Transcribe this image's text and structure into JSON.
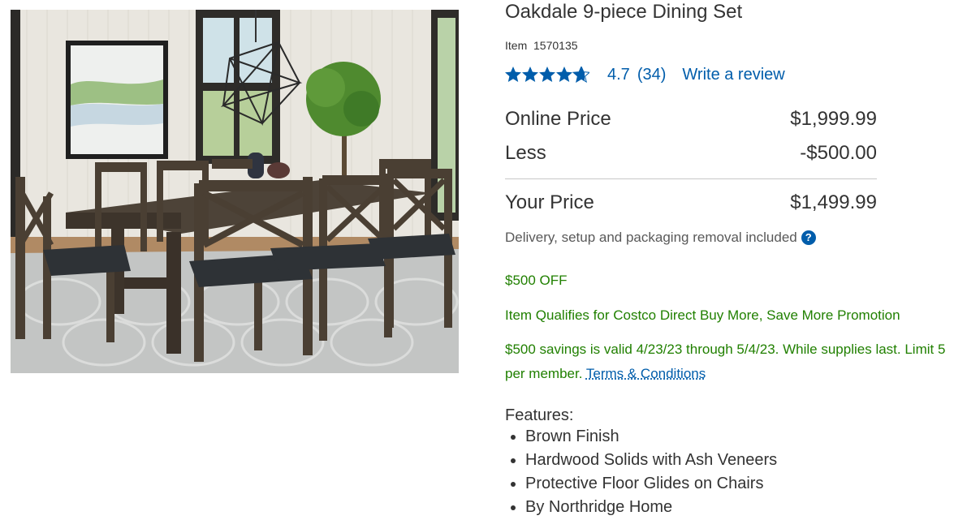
{
  "product": {
    "title": "Oakdale 9-piece Dining Set",
    "item_label": "Item",
    "item_number": "1570135",
    "rating": {
      "value": 4.7,
      "display": "4.7",
      "review_count": "(34)",
      "write_review_label": "Write a review",
      "star_color": "#005dab"
    }
  },
  "pricing": {
    "online_price_label": "Online Price",
    "online_price_value": "$1,999.99",
    "less_label": "Less",
    "less_value": "-$500.00",
    "your_price_label": "Your Price",
    "your_price_value": "$1,499.99",
    "delivery_note": "Delivery, setup and packaging removal included",
    "help_icon": "help-icon"
  },
  "promotion": {
    "off_text": "$500 OFF",
    "qualifies_text": "Item Qualifies for Costco Direct Buy More, Save More Promotion",
    "validity_text": "$500 savings is valid 4/23/23 through 5/4/23. While supplies last. Limit 5 per member.",
    "terms_label": "Terms & Conditions",
    "promo_color": "#218001",
    "link_color": "#005dab"
  },
  "features": {
    "heading": "Features:",
    "items": [
      "Brown Finish",
      "Hardwood Solids with Ash Veneers",
      "Protective Floor Glides on Chairs",
      "By Northridge Home"
    ]
  },
  "image": {
    "subject": "dining-set-photo"
  }
}
